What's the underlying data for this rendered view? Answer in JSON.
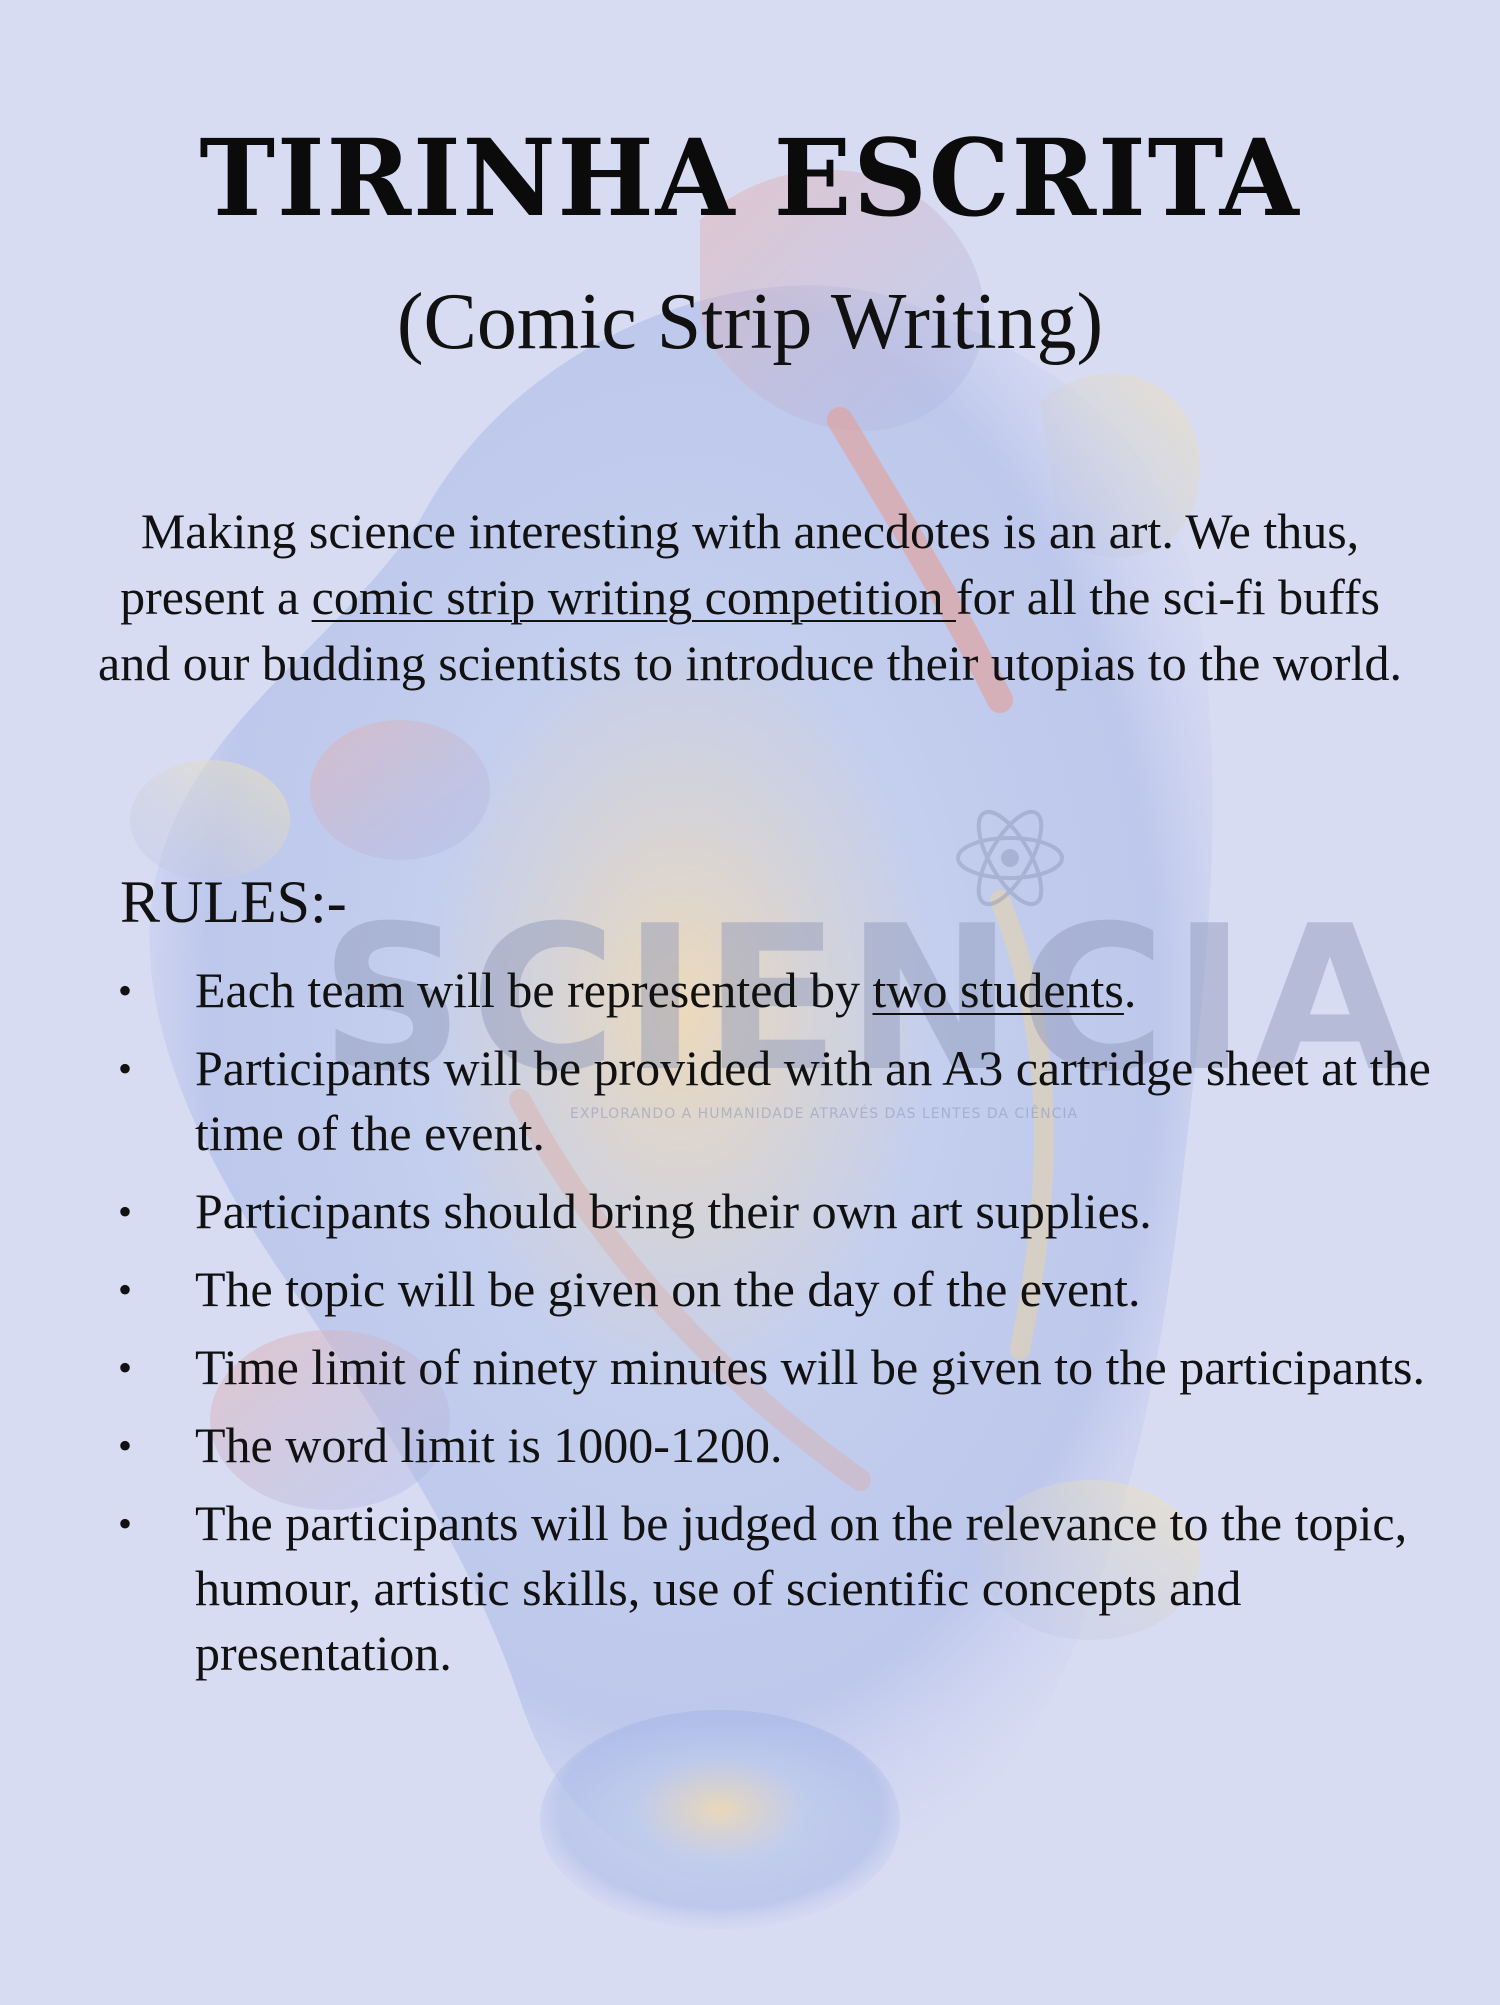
{
  "header": {
    "title": "TIRINHA ESCRITA",
    "subtitle": "(Comic Strip Writing)"
  },
  "intro": {
    "part1": "Making science interesting with anecdotes is an art. We thus, present a ",
    "link_text": "comic strip writing competition ",
    "part2": "for all the sci-fi buffs and our budding scientists to introduce their utopias to the world."
  },
  "rules": {
    "heading": "RULES:-",
    "bullet_glyph": "•",
    "items": [
      {
        "pre": "Each team will be represented by ",
        "underlined": "two students",
        "post": "."
      },
      {
        "text": "Participants will be provided with an A3 cartridge sheet at the time of the event."
      },
      {
        "text": "Participants should bring their own art supplies."
      },
      {
        "text": "The topic will be given  on the day of the event."
      },
      {
        "text": "Time  limit of ninety minutes will be given  to the participants."
      },
      {
        "text": "The word limit is 1000-1200."
      },
      {
        "text": "The participants will be judged on the relevance to the topic, humour, artistic skills,  use of scientific concepts and presentation."
      }
    ]
  },
  "watermark": {
    "logo_text": "SCIENCIA",
    "tagline": "EXPLORANDO A HUMANIDADE ATRAVÉS DAS LENTES DA CIÊNCIA"
  },
  "colors": {
    "background": "#d8dcf3",
    "text": "#111111",
    "watermark_logo": "#8e97b8"
  }
}
